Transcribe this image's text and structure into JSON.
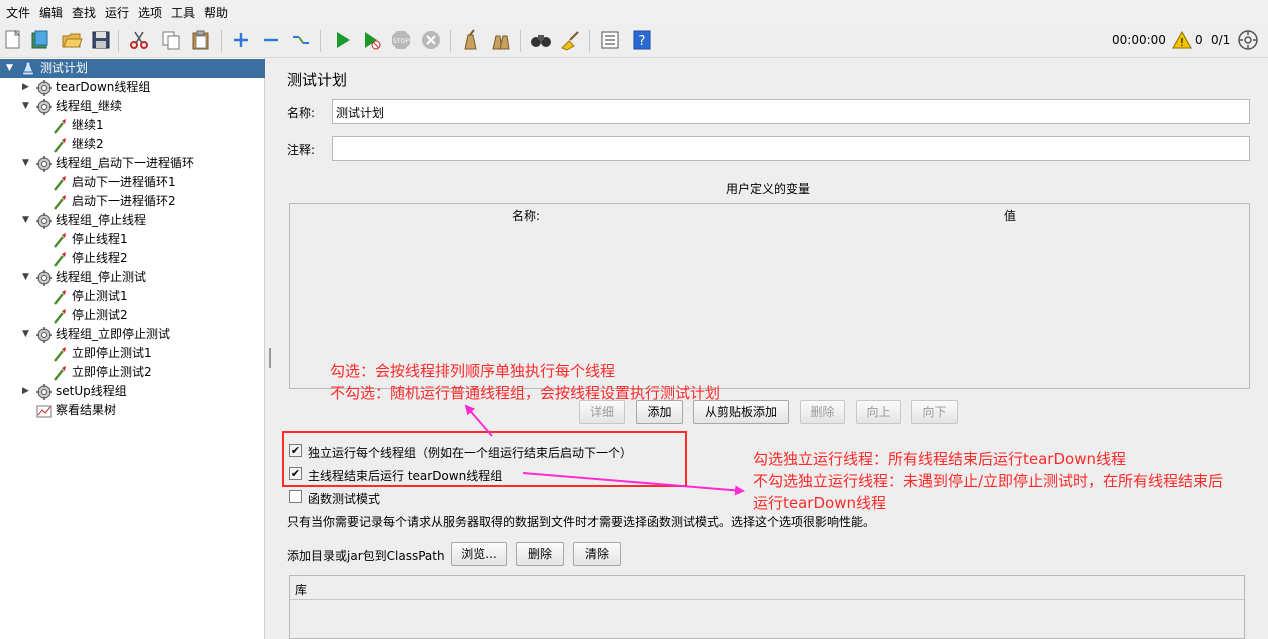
{
  "menubar": {
    "items": [
      "文件",
      "编辑",
      "查找",
      "运行",
      "选项",
      "工具",
      "帮助"
    ]
  },
  "toolbar": {
    "icons": [
      "new-icon",
      "templates-icon",
      "open-icon",
      "save-icon",
      "cut-icon",
      "copy-icon",
      "paste-icon",
      "expand-icon",
      "collapse-icon",
      "toggle-icon",
      "start-icon",
      "start-no-pause-icon",
      "stop-icon",
      "shutdown-icon",
      "clear-icon",
      "clear-all-icon",
      "search-icon",
      "reset-search-icon",
      "function-helper-icon",
      "help-icon"
    ],
    "timer": "00:00:00",
    "warning_count": "0",
    "threads": "0/1",
    "colors": {
      "accent": "#3a6fa0",
      "start_green": "#1a9a2a",
      "warning_yellow": "#f5c400"
    }
  },
  "tree": {
    "nodes": [
      {
        "label": "测试计划",
        "type": "plan",
        "toggle": "▼"
      },
      {
        "label": "tearDown线程组",
        "type": "group",
        "toggle": "▶"
      },
      {
        "label": "线程组_继续",
        "type": "group",
        "toggle": "▼"
      },
      {
        "label": "继续1",
        "type": "sampler",
        "toggle": ""
      },
      {
        "label": "继续2",
        "type": "sampler",
        "toggle": ""
      },
      {
        "label": "线程组_启动下一进程循环",
        "type": "group",
        "toggle": "▼"
      },
      {
        "label": "启动下一进程循环1",
        "type": "sampler",
        "toggle": ""
      },
      {
        "label": "启动下一进程循环2",
        "type": "sampler",
        "toggle": ""
      },
      {
        "label": "线程组_停止线程",
        "type": "group",
        "toggle": "▼"
      },
      {
        "label": "停止线程1",
        "type": "sampler",
        "toggle": ""
      },
      {
        "label": "停止线程2",
        "type": "sampler",
        "toggle": ""
      },
      {
        "label": "线程组_停止测试",
        "type": "group",
        "toggle": "▼"
      },
      {
        "label": "停止测试1",
        "type": "sampler",
        "toggle": ""
      },
      {
        "label": "停止测试2",
        "type": "sampler",
        "toggle": ""
      },
      {
        "label": "线程组_立即停止测试",
        "type": "group",
        "toggle": "▼"
      },
      {
        "label": "立即停止测试1",
        "type": "sampler",
        "toggle": ""
      },
      {
        "label": "立即停止测试2",
        "type": "sampler",
        "toggle": ""
      },
      {
        "label": "setUp线程组",
        "type": "group",
        "toggle": "▶"
      },
      {
        "label": "察看结果树",
        "type": "listener",
        "toggle": ""
      }
    ]
  },
  "panel": {
    "title": "测试计划",
    "name_label": "名称:",
    "name_value": "测试计划",
    "comment_label": "注释:",
    "comment_value": "",
    "vars_title": "用户定义的变量",
    "vars_col_name": "名称:",
    "vars_col_value": "值",
    "buttons": {
      "detail": "详细",
      "add": "添加",
      "add_clipboard": "从剪贴板添加",
      "delete": "删除",
      "up": "向上",
      "down": "向下"
    },
    "checkbox_serial": {
      "label": "独立运行每个线程组（例如在一个组运行结束后启动下一个）",
      "checked": true
    },
    "checkbox_teardown": {
      "label": "主线程结束后运行 tearDown线程组",
      "checked": true
    },
    "checkbox_functional": {
      "label": "函数测试模式",
      "checked": false
    },
    "functional_note": "只有当你需要记录每个请求从服务器取得的数据到文件时才需要选择函数测试模式。选择这个选项很影响性能。",
    "classpath_label": "添加目录或jar包到ClassPath",
    "classpath_buttons": {
      "browse": "浏览...",
      "delete": "删除",
      "clear": "清除"
    },
    "library_header": "库"
  },
  "annotations": {
    "top_line1": "勾选：会按线程排列顺序单独执行每个线程",
    "top_line2": "不勾选：随机运行普通线程组，会按线程设置执行测试计划",
    "right_line1": "勾选独立运行线程：所有线程结束后运行tearDown线程",
    "right_line2": "不勾选独立运行线程：未遇到停止/立即停止测试时，在所有线程结束后",
    "right_line3": "运行tearDown线程",
    "color": "#ff2a2a",
    "arrow_color": "#ff2ad4"
  }
}
